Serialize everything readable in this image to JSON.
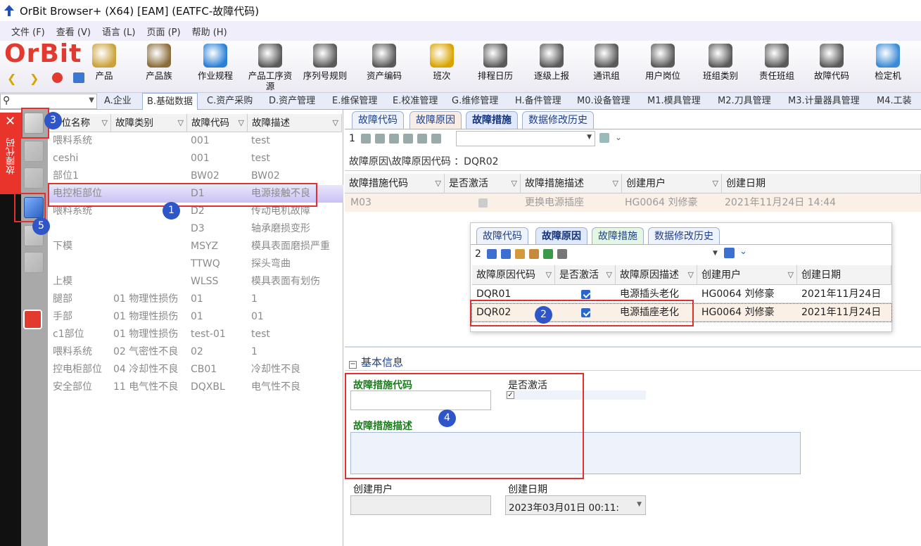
{
  "window": {
    "title": "OrBit Browser+ (X64) [EAM] (EATFC-故障代码)"
  },
  "menu": [
    "文件 (F)",
    "查看 (V)",
    "语言 (L)",
    "页面 (P)",
    "帮助 (H)"
  ],
  "logo": "OrBit",
  "toolbar": [
    "产品",
    "产品族",
    "作业规程",
    "产品工序资源",
    "序列号规则",
    "资产编码",
    "班次",
    "排程日历",
    "逐级上报",
    "通讯组",
    "用户岗位",
    "班组类别",
    "责任班组",
    "故障代码",
    "检定机"
  ],
  "module_tabs": [
    "A.企业",
    "B.基础数据",
    "C.资产采购",
    "D.资产管理",
    "E.维保管理",
    "E.校准管理",
    "G.维修管理",
    "H.备件管理",
    "M0.设备管理",
    "M1.模具管理",
    "M2.刀具管理",
    "M3.计量器具管理",
    "M4.工装"
  ],
  "sidebar": {
    "vertical_label": "故障代码"
  },
  "left_grid": {
    "headers": [
      "部位名称",
      "故障类别",
      "故障代码",
      "故障描述"
    ],
    "rows": [
      [
        "喂料系统",
        "",
        "001",
        "test"
      ],
      [
        "ceshi",
        "",
        "001",
        "test"
      ],
      [
        "部位1",
        "",
        "BW02",
        "BW02"
      ],
      [
        "电控柜部位",
        "",
        "D1",
        "电源接触不良"
      ],
      [
        "喂料系统",
        "",
        "D2",
        "传动电机故障"
      ],
      [
        "",
        "",
        "D3",
        "轴承磨损变形"
      ],
      [
        "下模",
        "",
        "MSYZ",
        "模具表面磨损严重"
      ],
      [
        "",
        "",
        "TTWQ",
        "探头弯曲"
      ],
      [
        "上模",
        "",
        "WLSS",
        "模具表面有划伤"
      ],
      [
        "腿部",
        "01 物理性损伤",
        "01",
        "1"
      ],
      [
        "手部",
        "01 物理性损伤",
        "01",
        "01"
      ],
      [
        "c1部位",
        "01 物理性损伤",
        "test-01",
        "test"
      ],
      [
        "喂料系统",
        "02 气密性不良",
        "02",
        "1"
      ],
      [
        "控电柜部位",
        "04 冷却性不良",
        "CB01",
        "冷却性不良"
      ],
      [
        "安全部位",
        "11 电气性不良",
        "DQXBL",
        "电气性不良"
      ]
    ]
  },
  "right": {
    "tabs": [
      "故障代码",
      "故障原因",
      "故障措施",
      "数据修改历史"
    ],
    "record_no": "1",
    "breadcrumb": "故障原因\\故障原因代码 ：DQR02",
    "grid": {
      "headers": [
        "故障措施代码",
        "是否激活",
        "故障措施描述",
        "创建用户",
        "创建日期"
      ],
      "rows": [
        [
          "M03",
          "",
          "更换电源插座",
          "HG0064 刘修豪",
          "2021年11月24日 14:44"
        ]
      ]
    }
  },
  "popup": {
    "tabs": [
      "故障代码",
      "故障原因",
      "故障措施",
      "数据修改历史"
    ],
    "record_no": "2",
    "headers": [
      "故障原因代码",
      "是否激活",
      "故障原因描述",
      "创建用户",
      "创建日期"
    ],
    "rows": [
      [
        "DQR01",
        "",
        "电源插头老化",
        "HG0064 刘修豪",
        "2021年11月24日"
      ],
      [
        "DQR02",
        "",
        "电源插座老化",
        "HG0064 刘修豪",
        "2021年11月24日"
      ]
    ]
  },
  "form": {
    "section": "基本信息",
    "code_label": "故障措施代码",
    "active_label": "是否激活",
    "desc_label": "故障措施描述",
    "user_label": "创建用户",
    "date_label": "创建日期",
    "date_value": "2023年03月01日 00:11:"
  },
  "badges": [
    "1",
    "2",
    "3",
    "4",
    "5"
  ]
}
